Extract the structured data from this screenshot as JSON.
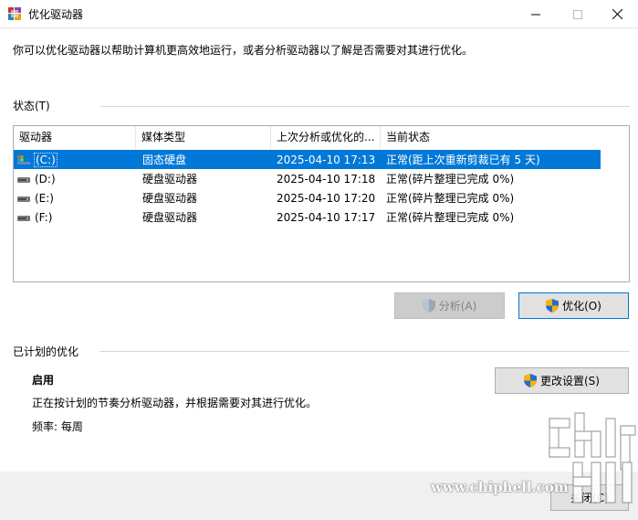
{
  "window": {
    "title": "优化驱动器",
    "icon": "defrag-app-icon",
    "controls": [
      "minimize",
      "maximize",
      "close"
    ]
  },
  "intro_text": "你可以优化驱动器以帮助计算机更高效地运行，或者分析驱动器以了解是否需要对其进行优化。",
  "status": {
    "label": "状态(T)",
    "columns": [
      "驱动器",
      "媒体类型",
      "上次分析或优化的...",
      "当前状态"
    ],
    "rows": [
      {
        "drive": "(C:)",
        "media": "固态硬盘",
        "last_run": "2025-04-10 17:13",
        "state": "正常(距上次重新剪裁已有 5 天)",
        "selected": true,
        "icon": "system-drive-icon"
      },
      {
        "drive": "(D:)",
        "media": "硬盘驱动器",
        "last_run": "2025-04-10 17:18",
        "state": "正常(碎片整理已完成 0%)",
        "selected": false,
        "icon": "hard-drive-icon"
      },
      {
        "drive": "(E:)",
        "media": "硬盘驱动器",
        "last_run": "2025-04-10 17:20",
        "state": "正常(碎片整理已完成 0%)",
        "selected": false,
        "icon": "hard-drive-icon"
      },
      {
        "drive": "(F:)",
        "media": "硬盘驱动器",
        "last_run": "2025-04-10 17:17",
        "state": "正常(碎片整理已完成 0%)",
        "selected": false,
        "icon": "hard-drive-icon"
      }
    ],
    "analyze_button": "分析(A)",
    "optimize_button": "优化(O)"
  },
  "scheduled": {
    "label": "已计划的优化",
    "state": "启用",
    "description": "正在按计划的节奏分析驱动器，并根据需要对其进行优化。",
    "frequency": "频率: 每周",
    "change_settings_button": "更改设置(S)"
  },
  "footer": {
    "close_button": "关闭(C)"
  },
  "watermark": {
    "text": "www.chiphell.com"
  },
  "colors": {
    "selection": "#0078d7",
    "footer_bg": "#f0f0f0",
    "button_bg": "#e1e1e1"
  }
}
